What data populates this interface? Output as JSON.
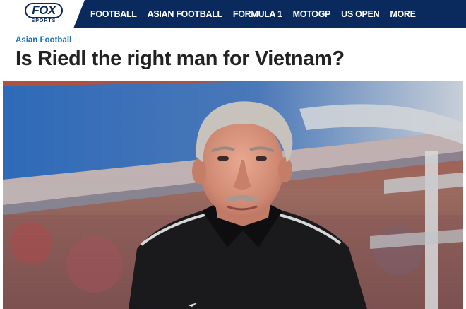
{
  "brand": {
    "logo_text": "FOX",
    "logo_sub": "SPORTS"
  },
  "nav": {
    "items": [
      {
        "label": "FOOTBALL"
      },
      {
        "label": "ASIAN FOOTBALL"
      },
      {
        "label": "FORMULA 1"
      },
      {
        "label": "MOTOGP"
      },
      {
        "label": "US OPEN"
      },
      {
        "label": "MORE"
      }
    ]
  },
  "article": {
    "category": "Asian Football",
    "title": "Is Riedl the right man for Vietnam?"
  },
  "colors": {
    "nav_background": "#0a2a5e",
    "category": "#1a73c8",
    "headline": "#222222"
  }
}
